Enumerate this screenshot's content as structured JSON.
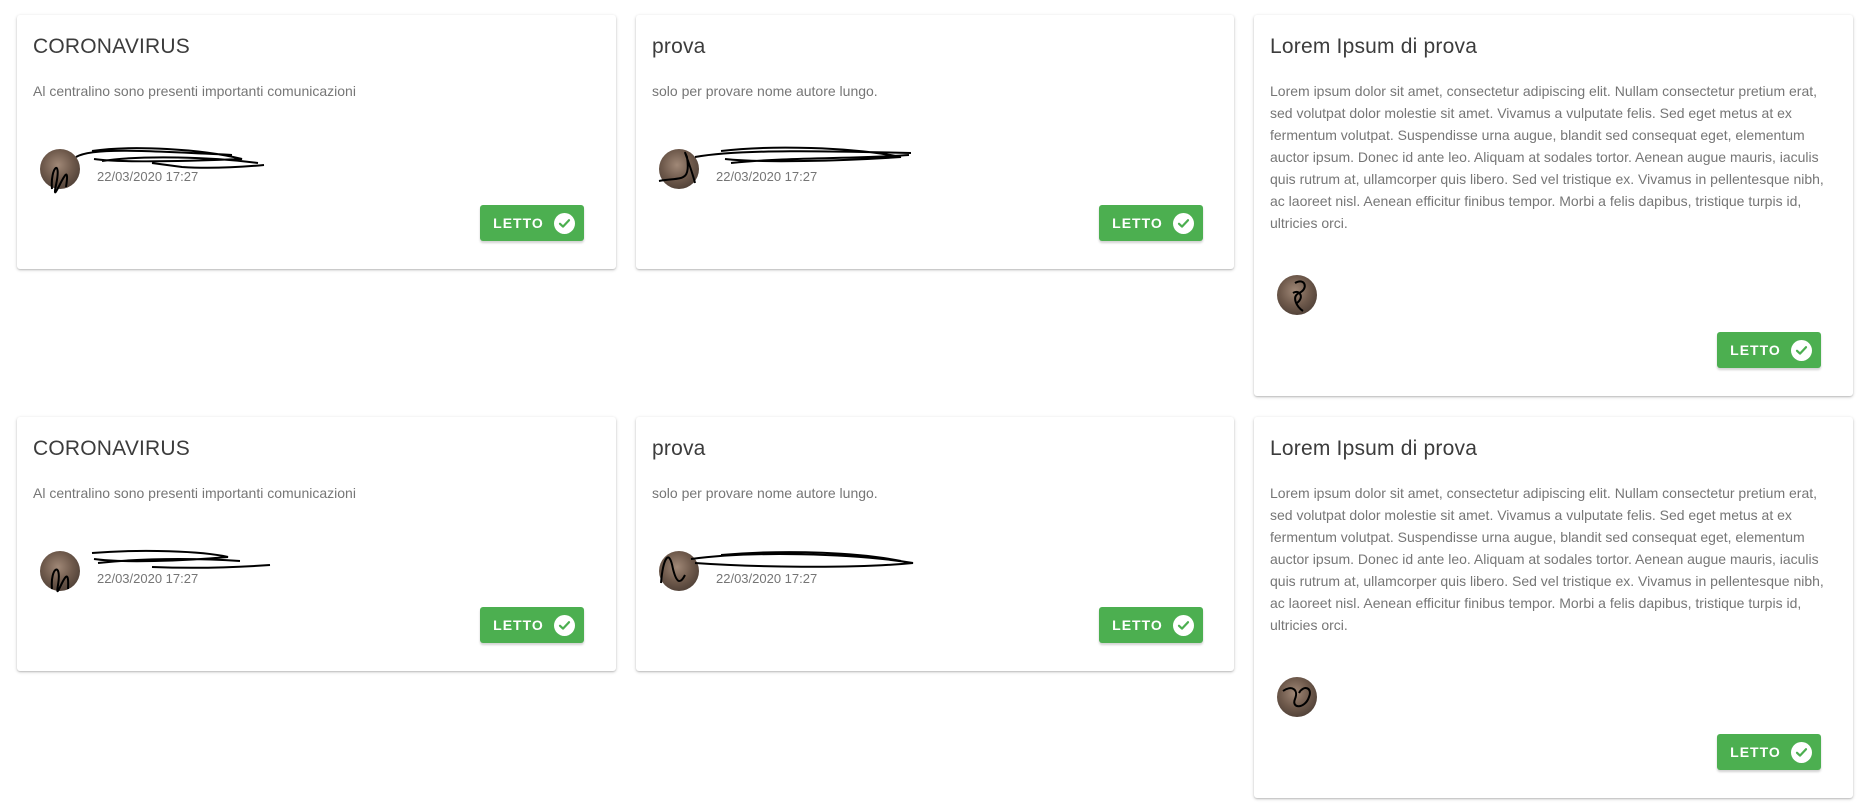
{
  "cards": [
    {
      "title": "CORONAVIRUS",
      "body": "Al centralino sono presenti importanti comunicazioni",
      "author_name": "",
      "date": "22/03/2020 17:27",
      "button_label": "LETTO",
      "icon": "check-circle-icon"
    },
    {
      "title": "prova",
      "body": "solo per provare nome autore lungo.",
      "author_name": "",
      "date": "22/03/2020 17:27",
      "button_label": "LETTO",
      "icon": "check-circle-icon"
    },
    {
      "title": "Lorem Ipsum di prova",
      "body": "Lorem ipsum dolor sit amet, consectetur adipiscing elit. Nullam consectetur pretium erat, sed volutpat dolor molestie sit amet. Vivamus a vulputate felis. Sed eget metus at ex fermentum volutpat. Suspendisse urna augue, blandit sed consequat eget, elementum auctor ipsum. Donec id ante leo. Aliquam at sodales tortor. Aenean augue mauris, iaculis quis rutrum at, ullamcorper quis libero. Sed vel tristique ex. Vivamus in pellentesque nibh, ac laoreet nisl. Aenean efficitur finibus tempor. Morbi a felis dapibus, tristique turpis id, ultricies orci.",
      "author_name": "",
      "date": "",
      "button_label": "LETTO",
      "icon": "check-circle-icon"
    },
    {
      "title": "CORONAVIRUS",
      "body": "Al centralino sono presenti importanti comunicazioni",
      "author_name": "",
      "date": "22/03/2020 17:27",
      "button_label": "LETTO",
      "icon": "check-circle-icon"
    },
    {
      "title": "prova",
      "body": "solo per provare nome autore lungo.",
      "author_name": "",
      "date": "22/03/2020 17:27",
      "button_label": "LETTO",
      "icon": "check-circle-icon"
    },
    {
      "title": "Lorem Ipsum di prova",
      "body": "Lorem ipsum dolor sit amet, consectetur adipiscing elit. Nullam consectetur pretium erat, sed volutpat dolor molestie sit amet. Vivamus a vulputate felis. Sed eget metus at ex fermentum volutpat. Suspendisse urna augue, blandit sed consequat eget, elementum auctor ipsum. Donec id ante leo. Aliquam at sodales tortor. Aenean augue mauris, iaculis quis rutrum at, ullamcorper quis libero. Sed vel tristique ex. Vivamus in pellentesque nibh, ac laoreet nisl. Aenean efficitur finibus tempor. Morbi a felis dapibus, tristique turpis id, ultricies orci.",
      "author_name": "",
      "date": "",
      "button_label": "LETTO",
      "icon": "check-circle-icon"
    }
  ],
  "colors": {
    "button": "#4caf50",
    "title": "#3c3c3c",
    "body": "#767676"
  }
}
